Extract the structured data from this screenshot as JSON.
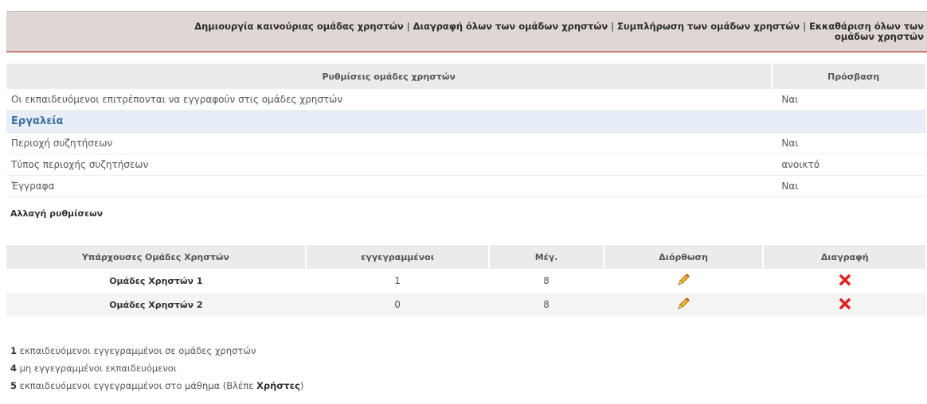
{
  "toolbar": {
    "create_group": "Δημιουργία καινούριας ομάδας χρηστών",
    "delete_all": "Διαγραφή όλων των ομάδων χρηστών",
    "fill_groups": "Συμπλήρωση των ομάδων χρηστών",
    "clear_groups": "Εκκαθάριση όλων των ομάδων χρηστών"
  },
  "settings": {
    "header_setting": "Ρυθμίσεις ομάδες χρηστών",
    "header_access": "Πρόσβαση",
    "rows": [
      {
        "label": "Οι εκπαιδευόμενοι επιτρέπονται να εγγραφούν στις ομάδες χρηστών",
        "value": "Ναι"
      }
    ],
    "tools_title": "Εργαλεία",
    "tool_rows": [
      {
        "label": "Περιοχή συζητήσεων",
        "value": "Ναι"
      },
      {
        "label": "Τύπος περιοχής συζητήσεων",
        "value": "ανοικτό"
      },
      {
        "label": "Έγγραφα",
        "value": "Ναι"
      }
    ],
    "change_link": "Αλλαγή ρυθμίσεων"
  },
  "groups": {
    "headers": {
      "name": "Υπάρχουσες Ομάδες Χρηστών",
      "registered": "εγγεγραμμένοι",
      "max": "Μέγ.",
      "edit": "Διόρθωση",
      "delete": "Διαγραφή"
    },
    "rows": [
      {
        "name": "Ομάδες Χρηστών 1",
        "registered": "1",
        "max": "8"
      },
      {
        "name": "Ομάδες Χρηστών 2",
        "registered": "0",
        "max": "8"
      }
    ]
  },
  "summary": {
    "line1_count": "1",
    "line1_text": "εκπαιδευόμενοι εγγεγραμμένοι σε ομάδες χρηστών",
    "line2_count": "4",
    "line2_text": "μη εγγεγραμμένοι εκπαιδευόμενοι",
    "line3_count": "5",
    "line3_text": "εκπαιδευόμενοι εγγεγραμμένοι στο μάθημα (Βλέπε",
    "line3_link": "Χρήστες",
    "line3_close": ")"
  },
  "colors": {
    "toolbar_bg": "#dfd7d4",
    "toolbar_border": "#c97777",
    "tools_bg": "#e7eef7",
    "tools_text": "#3b6ea5",
    "edit_icon": "#e0a020",
    "delete_icon": "#e02020"
  },
  "icons": {
    "edit": "pencil-icon",
    "delete": "red-x-icon"
  }
}
